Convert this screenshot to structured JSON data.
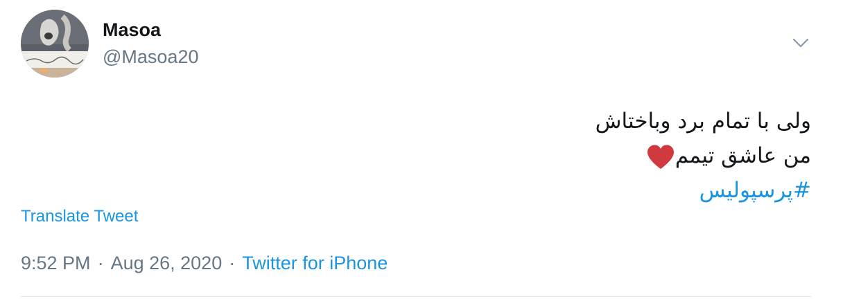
{
  "author": {
    "name": "Masoa",
    "handle": "@Masoa20"
  },
  "tweet": {
    "line1": "ولی با تمام برد وباختاش",
    "line2": "من عاشق تیمم",
    "hashtag": "#پرسپولیس",
    "heart_icon": "heart-icon",
    "heart_color": "#d0393e"
  },
  "translate_label": "Translate Tweet",
  "meta": {
    "time": "9:52 PM",
    "separator": "·",
    "date": "Aug 26, 2020",
    "source": "Twitter for iPhone"
  },
  "colors": {
    "link": "#1b95e0",
    "muted": "#657786",
    "text": "#14171a"
  }
}
